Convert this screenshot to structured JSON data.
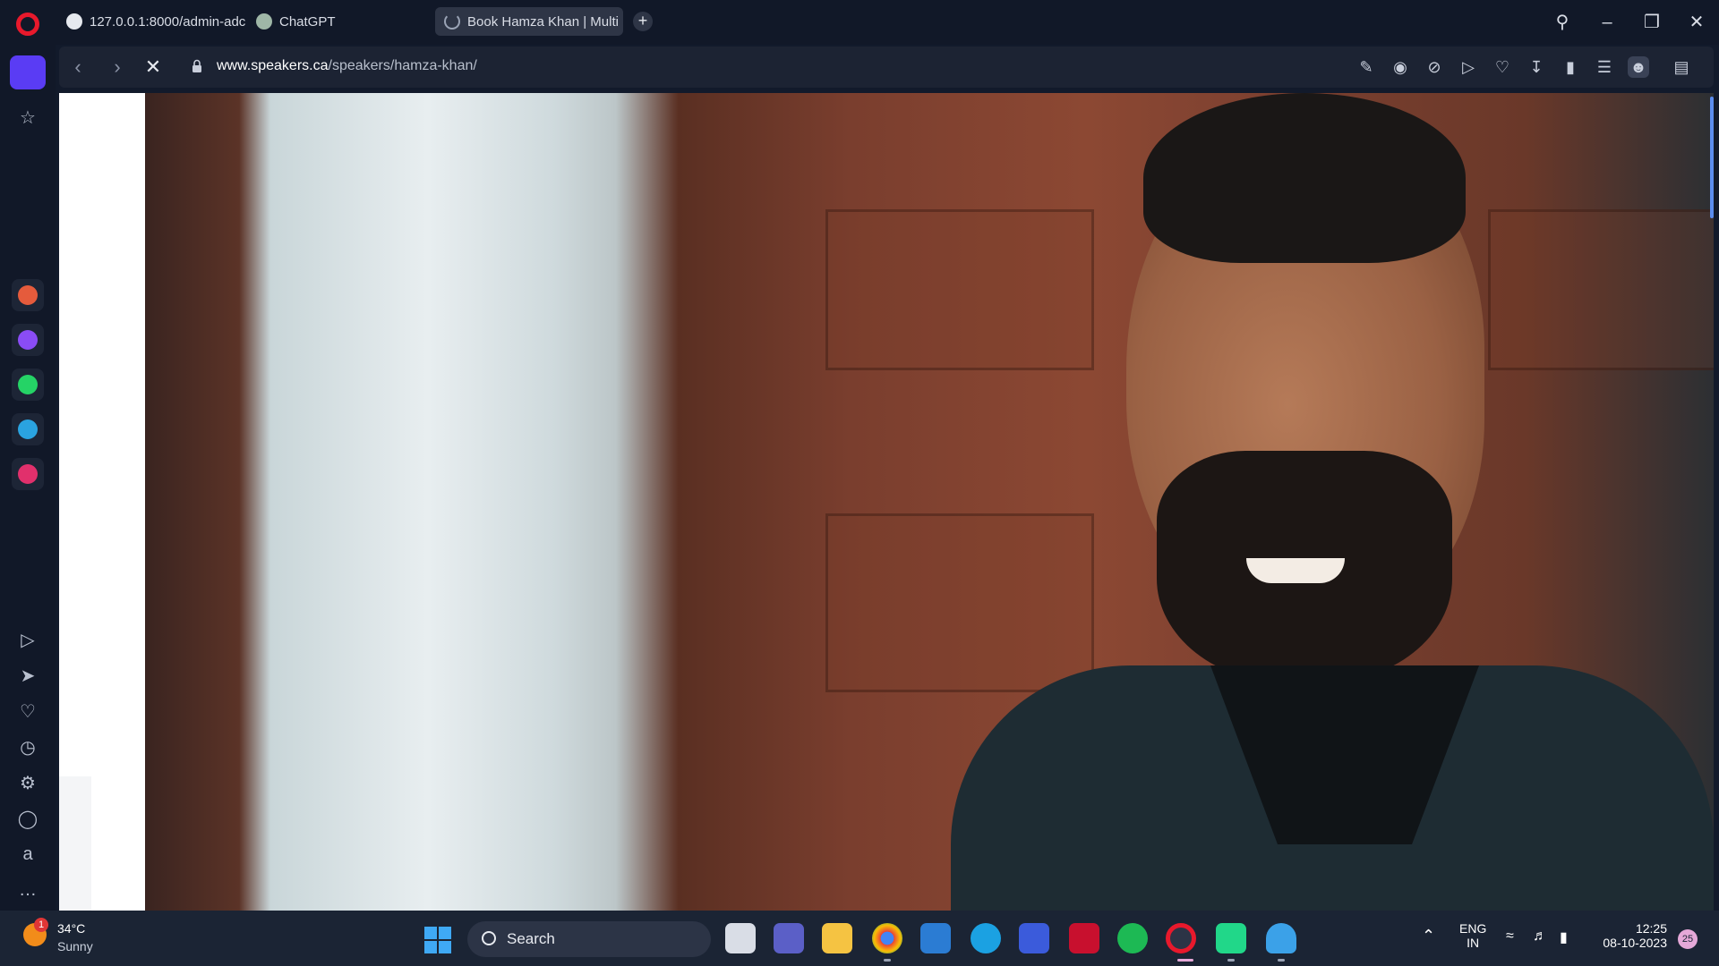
{
  "browser": {
    "tabs": [
      {
        "label": "127.0.0.1:8000/admin-adc",
        "favicon_color": "#e6e9ef"
      },
      {
        "label": "ChatGPT",
        "favicon_color": "#9fb7a7"
      },
      {
        "label": "Book Hamza Khan | Multi",
        "favicon_color": "#9aa3b5",
        "active": true
      }
    ],
    "new_tab_label": "+",
    "url_domain": "www.speakers.ca",
    "url_path": "/speakers/hamza-khan/"
  },
  "sidebar": {
    "items": [
      "home-icon",
      "star-icon",
      "aria-icon",
      "messenger-icon",
      "whatsapp-icon",
      "telegram-icon",
      "instagram-icon",
      "player-icon",
      "send-icon",
      "heart-icon",
      "history-icon",
      "settings-icon",
      "lightbulb-icon",
      "amazon-icon",
      "more-icon"
    ]
  },
  "page": {
    "image_subject": "Man with beard smiling, wooden door background"
  },
  "taskbar": {
    "weather_temp": "34°C",
    "weather_condition": "Sunny",
    "weather_badge": "1",
    "search_label": "Search",
    "lang_top": "ENG",
    "lang_bottom": "IN",
    "time": "12:25",
    "date": "08-10-2023",
    "notification_count": "25"
  }
}
